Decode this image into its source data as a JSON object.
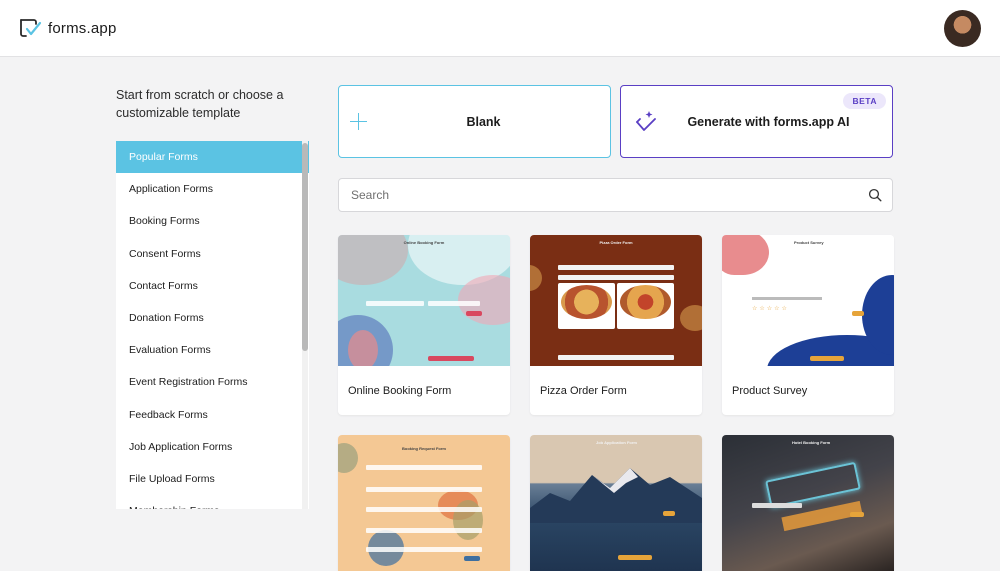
{
  "app": {
    "logo_text": "forms.app"
  },
  "intro": {
    "text": "Start from scratch or choose a customizable template"
  },
  "categories": [
    {
      "label": "Popular Forms",
      "active": true
    },
    {
      "label": "Application Forms"
    },
    {
      "label": "Booking Forms"
    },
    {
      "label": "Consent Forms"
    },
    {
      "label": "Contact Forms"
    },
    {
      "label": "Donation Forms"
    },
    {
      "label": "Evaluation Forms"
    },
    {
      "label": "Event Registration Forms"
    },
    {
      "label": "Feedback Forms"
    },
    {
      "label": "Job Application Forms"
    },
    {
      "label": "File Upload Forms"
    },
    {
      "label": "Membership Forms"
    }
  ],
  "start_options": {
    "blank_label": "Blank",
    "ai_label": "Generate with forms.app AI",
    "ai_badge": "BETA"
  },
  "search": {
    "placeholder": "Search",
    "value": ""
  },
  "templates": [
    {
      "title": "Online Booking Form",
      "thumb_title": "Online Booking Form"
    },
    {
      "title": "Pizza Order Form",
      "thumb_title": "Pizza Order Form"
    },
    {
      "title": "Product Survey",
      "thumb_title": "Product Survey"
    },
    {
      "title": "",
      "thumb_title": "Booking Request Form"
    },
    {
      "title": "",
      "thumb_title": "Job Application Form"
    },
    {
      "title": "",
      "thumb_title": "Hotel Booking Form"
    }
  ],
  "colors": {
    "accent": "#5bc3e3",
    "ai_accent": "#5a3fc4",
    "background": "#f3f3f4"
  }
}
